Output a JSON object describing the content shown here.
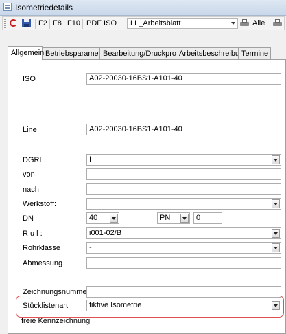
{
  "window": {
    "title": "Isometriedetails"
  },
  "toolbar": {
    "f2": "F2",
    "f8": "F8",
    "f10": "F10",
    "pdf_iso": "PDF ISO",
    "layout_select": "LL_Arbeitsblatt",
    "alle": "Alle"
  },
  "tabs": [
    "Allgemein",
    "Betriebsparameter",
    "Bearbeitung/Druckproben",
    "Arbeitsbeschreibung",
    "Termine"
  ],
  "form": {
    "iso": {
      "label": "ISO",
      "value": "A02-20030-16BS1-A101-40"
    },
    "line": {
      "label": "Line",
      "value": "A02-20030-16BS1-A101-40"
    },
    "dgrl": {
      "label": "DGRL",
      "value": "I"
    },
    "von": {
      "label": "von",
      "value": ""
    },
    "nach": {
      "label": "nach",
      "value": ""
    },
    "werkstoff": {
      "label": "Werkstoff:",
      "value": ""
    },
    "dn": {
      "label": "DN",
      "value": "40"
    },
    "pn": {
      "label": "PN",
      "value": "0"
    },
    "rul": {
      "label": "R u l :",
      "value": "i001-02/B"
    },
    "rohrklasse": {
      "label": "Rohrklasse",
      "value": "-"
    },
    "abmessung": {
      "label": "Abmessung",
      "value": ""
    },
    "zeichnungsnummer": {
      "label": "Zeichnungsnummer",
      "value": ""
    },
    "stuecklistenart": {
      "label": "Stücklistenart",
      "value": "fiktive Isometrie"
    },
    "freie_kennzeichnung": {
      "label": "freie Kennzeichnung"
    }
  },
  "colors": {
    "highlight": "#e05050",
    "panel": "#ffffff",
    "window_bg": "#f0f0f0"
  }
}
